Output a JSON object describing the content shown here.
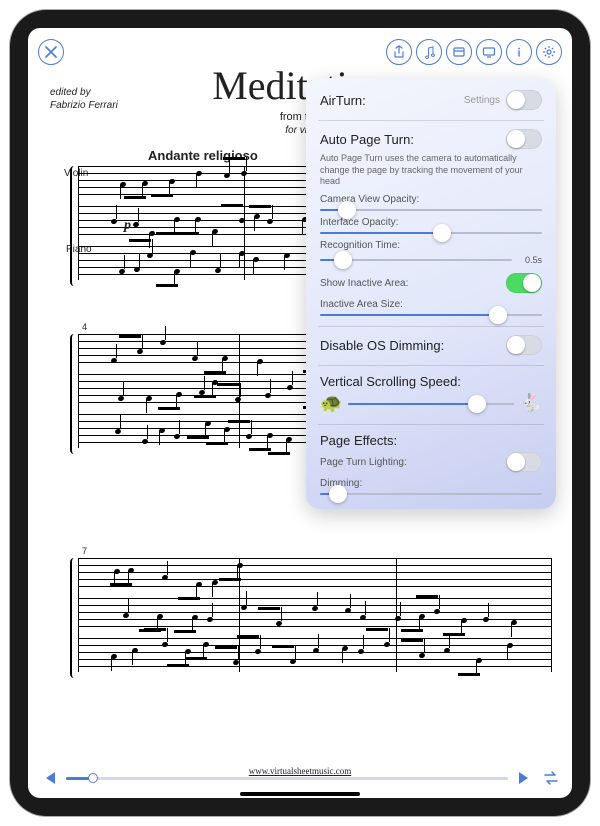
{
  "sheet": {
    "title": "Meditation",
    "subtitle_prefix": "from the",
    "for_prefix": "for viol",
    "editor_label": "edited by",
    "editor_name": "Fabrizio Ferrari",
    "tempo": "Andante religioso",
    "instrument_violin": "Violin",
    "instrument_piano": "Piano",
    "dynamic_p": "p",
    "bar_4": "4",
    "bar_7": "7",
    "footer": "www.virtualsheetmusic.com"
  },
  "toolbar": {
    "icons": [
      "share",
      "music-note",
      "card",
      "display",
      "info",
      "gear"
    ]
  },
  "settings": {
    "airturn": {
      "label": "AirTurn:",
      "link": "Settings",
      "on": false
    },
    "autopage": {
      "label": "Auto Page Turn:",
      "on": false,
      "desc": "Auto Page Turn uses the camera to automatically change the page by tracking the movement of your head",
      "camera_opacity": "Camera View Opacity:",
      "interface_opacity": "Interface Opacity:",
      "recognition_time": "Recognition Time:",
      "recognition_value": "0.5s",
      "show_inactive": "Show Inactive Area:",
      "show_inactive_on": true,
      "inactive_size": "Inactive Area Size:"
    },
    "dimming": {
      "label": "Disable OS Dimming:",
      "on": false
    },
    "scroll": {
      "label": "Vertical Scrolling Speed:"
    },
    "effects": {
      "label": "Page Effects:",
      "lighting": "Page Turn Lighting:",
      "lighting_on": false,
      "dimming": "Dimming:"
    }
  },
  "sliders": {
    "camera_opacity_pct": 12,
    "interface_opacity_pct": 55,
    "recognition_time_pct": 12,
    "inactive_size_pct": 80,
    "scroll_speed_pct": 78,
    "effects_dimming_pct": 8
  },
  "transport": {
    "progress_pct": 6
  }
}
